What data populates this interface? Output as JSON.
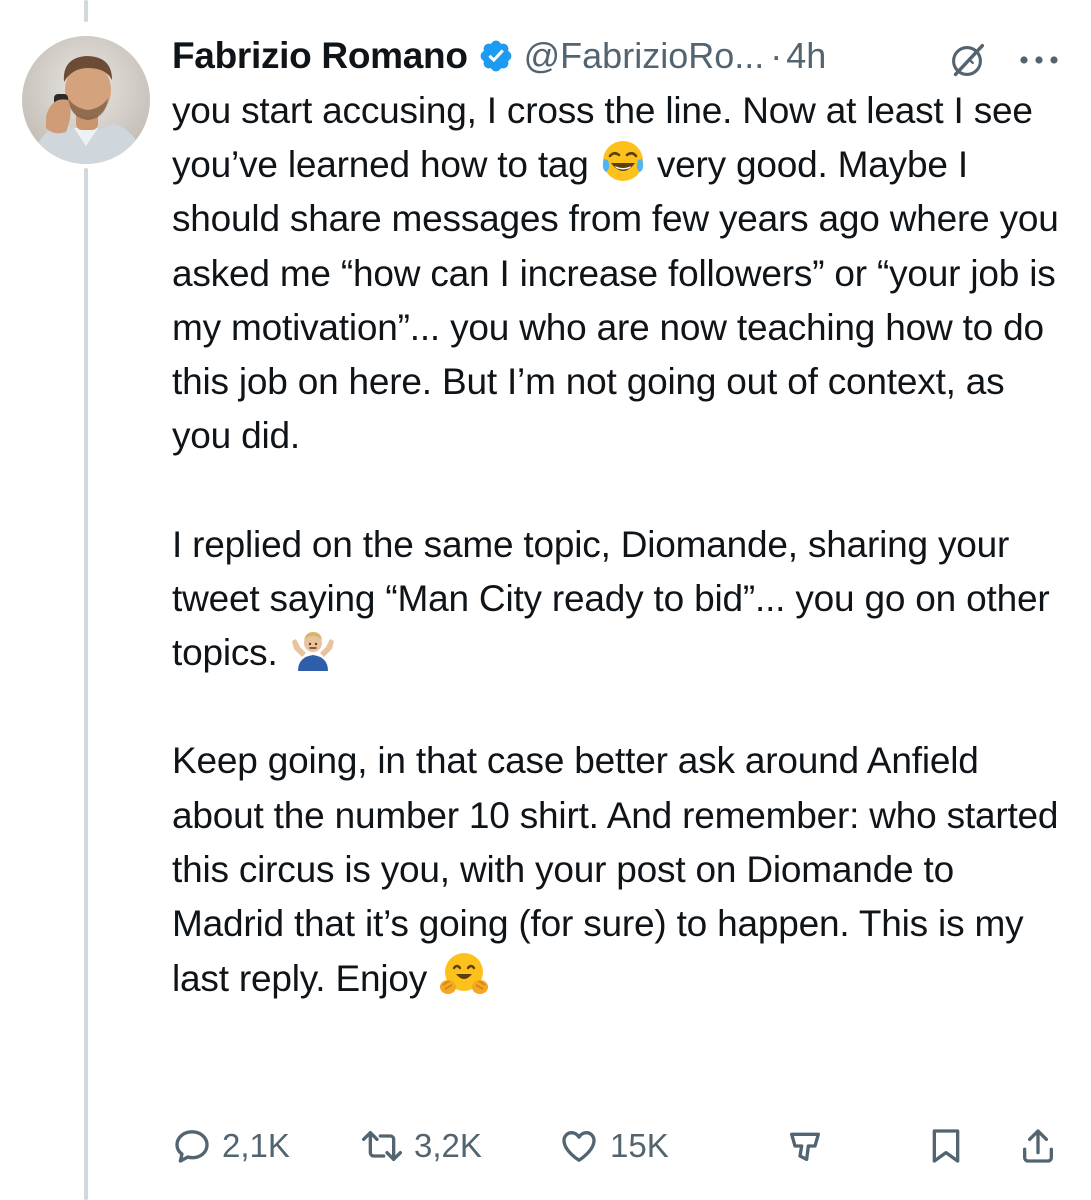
{
  "tweet": {
    "author_name": "Fabrizio Romano",
    "handle": "@FabrizioRo...",
    "separator": "·",
    "time": "4h",
    "paragraphs": [
      [
        {
          "t": "you start accusing, I cross the line. Now at least I see you’ve learned how to tag "
        },
        {
          "emoji": "face-with-tears-of-joy"
        },
        {
          "t": " very good. Maybe I should share messages from few years ago where you asked me “how can I increase followers” or “your job is my motivation”... you who are now teaching how to do this job on here. But I’m not going out of context, as you did."
        }
      ],
      [
        {
          "t": "I replied on the same topic, Diomande, sharing your tweet saying “Man City ready to bid”... you go on other topics. "
        },
        {
          "emoji": "person-shrugging"
        }
      ],
      [
        {
          "t": "Keep going, in that case better ask around Anfield about the number 10 shirt. And remember: who started this circus is you, with your post on Diomande to Madrid that it’s going (for sure) to happen. This is my last reply. Enjoy "
        },
        {
          "emoji": "hugging-face"
        }
      ]
    ]
  },
  "actions": {
    "replies": "2,1K",
    "reposts": "3,2K",
    "likes": "15K"
  },
  "colors": {
    "text": "#0f1419",
    "secondary": "#536471",
    "verified": "#1d9bf0",
    "thread_line": "#cfd9de"
  },
  "icons": [
    "verified-badge-icon",
    "grok-icon",
    "more-icon",
    "reply-icon",
    "repost-icon",
    "like-icon",
    "views-icon",
    "bookmark-icon",
    "share-icon"
  ]
}
